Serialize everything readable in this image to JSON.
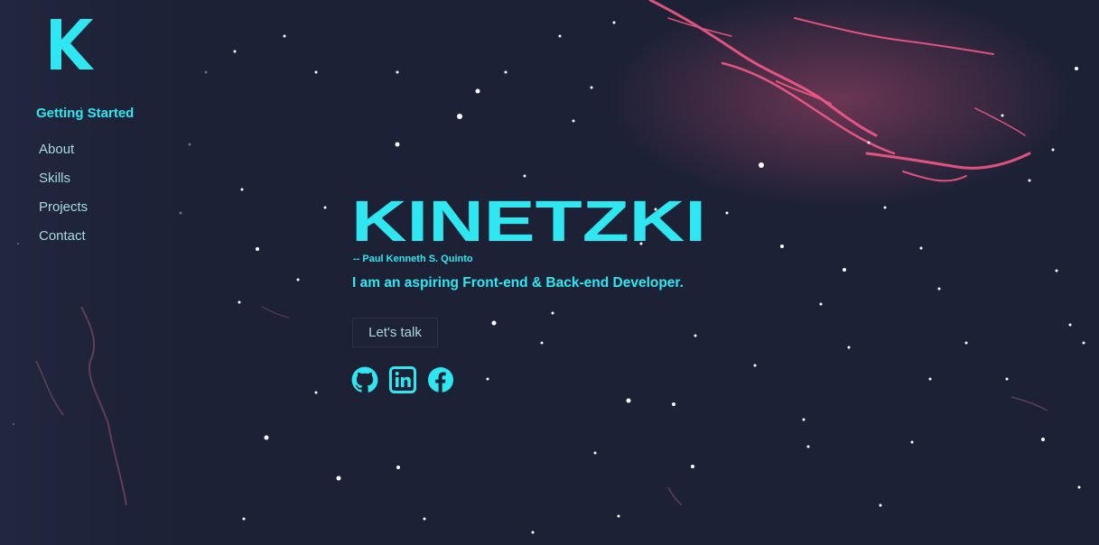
{
  "brand": {
    "logo_letter": "K",
    "title": "KINETZKI",
    "author": "-- Paul Kenneth S. Quinto",
    "tagline": "I am an aspiring Front-end & Back-end Developer."
  },
  "sidebar": {
    "heading": "Getting Started",
    "items": [
      {
        "label": "About"
      },
      {
        "label": "Skills"
      },
      {
        "label": "Projects"
      },
      {
        "label": "Contact"
      }
    ]
  },
  "cta": {
    "label": "Let's talk"
  },
  "social": [
    {
      "icon": "github-icon"
    },
    {
      "icon": "linkedin-icon"
    },
    {
      "icon": "facebook-icon"
    }
  ],
  "colors": {
    "background": "#1c2136",
    "accent": "#2fe7f0",
    "nav_text": "#a9d9e0",
    "nebula": "#ff5c8a"
  }
}
